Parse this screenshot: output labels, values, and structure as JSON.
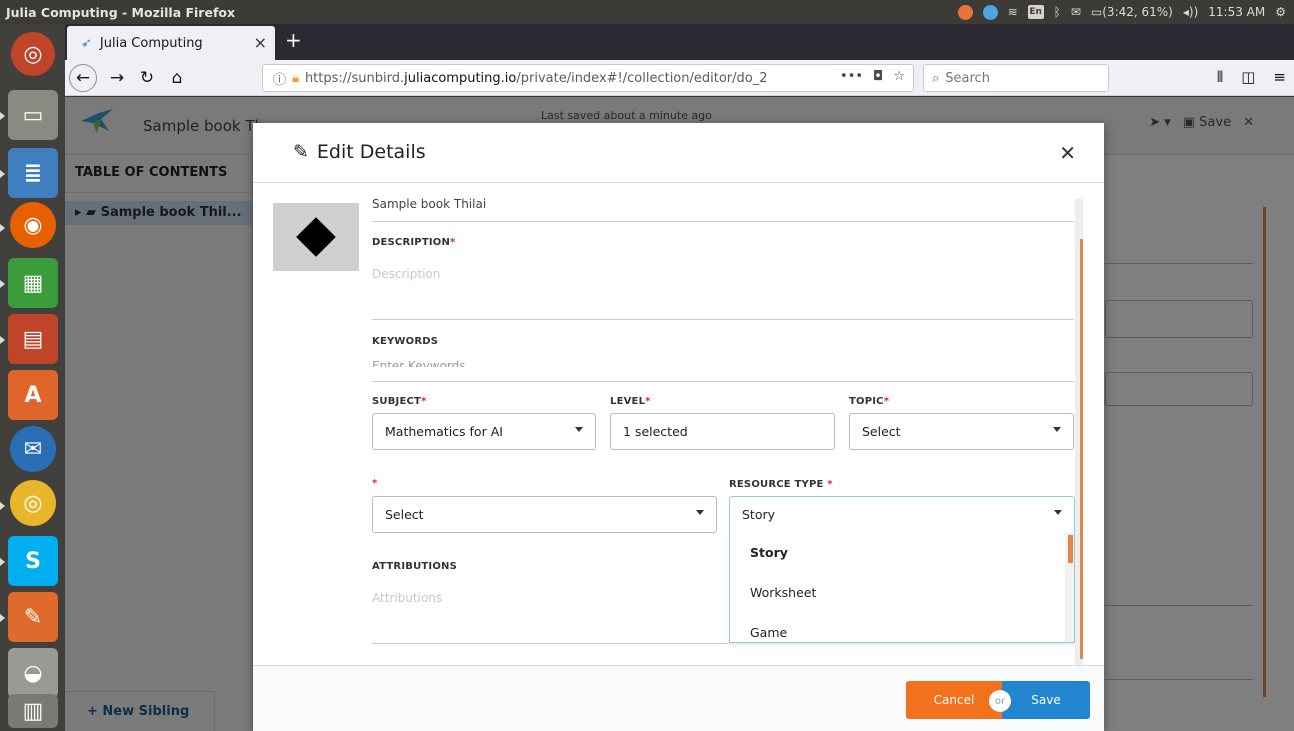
{
  "os": {
    "window_title": "Julia Computing - Mozilla Firefox",
    "keyboard": "En",
    "battery": "(3:42, 61%)",
    "clock": "11:53 AM"
  },
  "browser": {
    "tab_title": "Julia Computing",
    "url_prefix": "https://sunbird.",
    "url_host": "juliacomputing.io",
    "url_path": "/private/index#!/collection/editor/do_2",
    "search_placeholder": "Search"
  },
  "app": {
    "book_title": "Sample book Th...",
    "last_saved": "Last saved about a minute ago",
    "save_label": "Save",
    "toc_heading": "TABLE OF CONTENTS",
    "toc_item": "Sample book Thil...",
    "new_sibling": "+ New Sibling"
  },
  "modal": {
    "title": "Edit Details",
    "name_value_cut": "Sample book  Thilai",
    "description_label": "DESCRIPTION",
    "description_placeholder": "Description",
    "keywords_label": "KEYWORDS",
    "keywords_placeholder": "Enter Keywords",
    "subject_label": "SUBJECT",
    "subject_value": "Mathematics for AI",
    "level_label": "LEVEL",
    "level_value": "1 selected",
    "topic_label": "TOPIC",
    "topic_value": "Select",
    "unnamed_value": "Select",
    "resource_type_label": "RESOURCE TYPE",
    "resource_type_value": "Story",
    "resource_options": [
      "Story",
      "Worksheet",
      "Game"
    ],
    "attributions_label": "ATTRIBUTIONS",
    "attributions_placeholder": "Attributions",
    "cancel_label": "Cancel",
    "or_label": "or",
    "save_label": "Save"
  },
  "colors": {
    "cancel": "#f2711c",
    "save": "#2185d0",
    "accent": "#e2874b"
  }
}
